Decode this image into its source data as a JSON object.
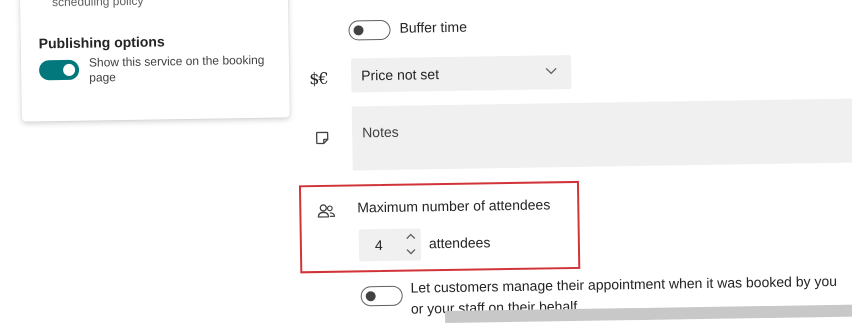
{
  "left_card": {
    "cut_text": "scheduling policy",
    "publishing_title": "Publishing options",
    "publish_toggle_on": true,
    "publish_label": "Show this service on the booking page"
  },
  "form": {
    "buffer_label": "Buffer time",
    "price_icon_text": "$€",
    "price_value": "Price not set",
    "notes_placeholder": "Notes",
    "attendees_title": "Maximum number of attendees",
    "attendees_value": "4",
    "attendees_unit": "attendees",
    "manage_label": "Let customers manage their appointment when it was booked by you or your staff on their behalf."
  },
  "colors": {
    "accent": "#03787c",
    "highlight": "#d13438",
    "field_bg": "#f0f0f0"
  },
  "icons": {
    "price": "currency-icon",
    "notes": "note-icon",
    "attendees": "people-icon",
    "dropdown": "chevron-down-icon",
    "stepper_up": "chevron-up-icon",
    "stepper_down": "chevron-down-icon"
  }
}
